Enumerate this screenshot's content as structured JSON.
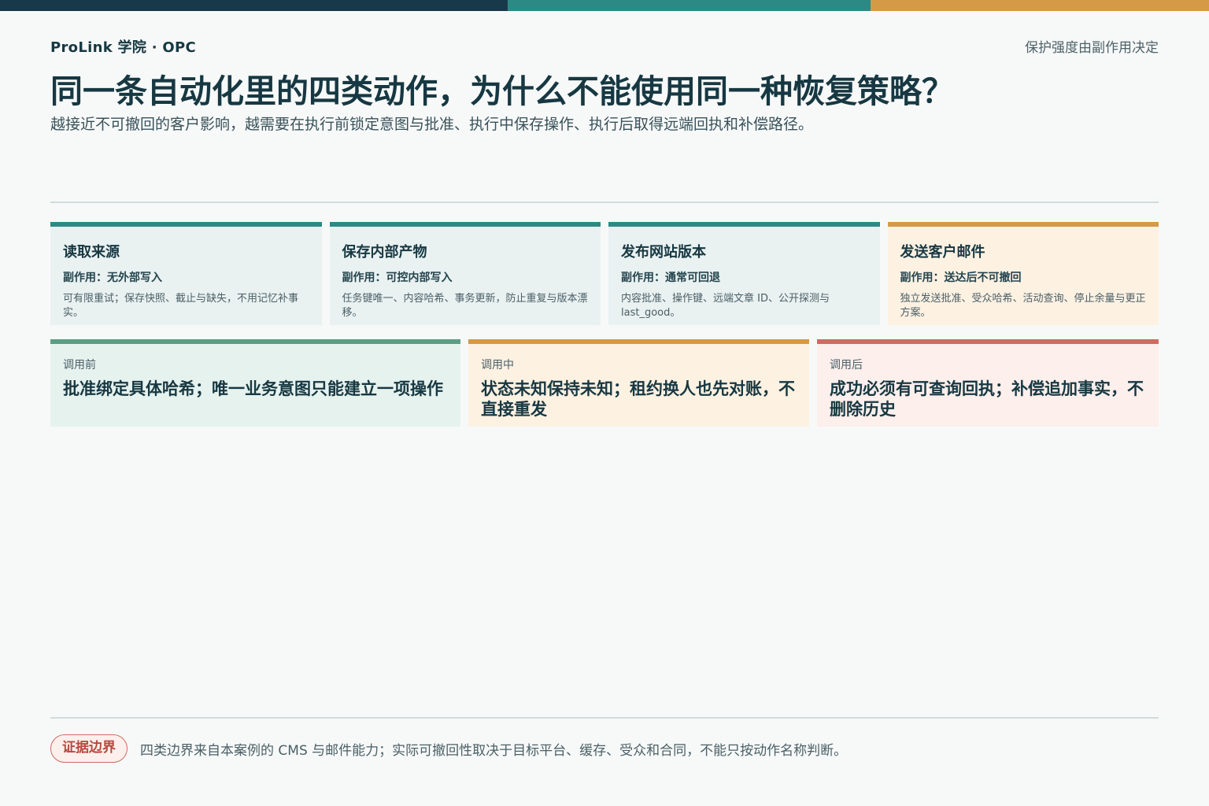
{
  "colors": {
    "navy": "#18394a",
    "teal": "#2b8a84",
    "orange": "#d49a46",
    "green": "#5a9e86",
    "red": "#cf6b60"
  },
  "header": {
    "brand": "ProLink 学院 · OPC",
    "note": "保护强度由副作用决定",
    "title": "同一条自动化里的四类动作，为什么不能使用同一种恢复策略？",
    "subtitle": "越接近不可撤回的客户影响，越需要在执行前锁定意图与批准、执行中保存操作、执行后取得远端回执和补偿路径。"
  },
  "actions": [
    {
      "title": "读取来源",
      "side_effect": "副作用：无外部写入",
      "desc": "可有限重试；保存快照、截止与缺失，不用记忆补事实。"
    },
    {
      "title": "保存内部产物",
      "side_effect": "副作用：可控内部写入",
      "desc": "任务键唯一、内容哈希、事务更新，防止重复与版本漂移。"
    },
    {
      "title": "发布网站版本",
      "side_effect": "副作用：通常可回退",
      "desc": "内容批准、操作键、远端文章 ID、公开探测与 last_good。"
    },
    {
      "title": "发送客户邮件",
      "side_effect": "副作用：送达后不可撤回",
      "desc": "独立发送批准、受众哈希、活动查询、停止余量与更正方案。"
    }
  ],
  "stages": [
    {
      "label": "调用前",
      "text": "批准绑定具体哈希；唯一业务意图只能建立一项操作"
    },
    {
      "label": "调用中",
      "text": "状态未知保持未知；租约换人也先对账，不直接重发"
    },
    {
      "label": "调用后",
      "text": "成功必须有可查询回执；补偿追加事实，不删除历史"
    }
  ],
  "footer": {
    "badge": "证据边界",
    "text": "四类边界来自本案例的 CMS 与邮件能力；实际可撤回性取决于目标平台、缓存、受众和合同，不能只按动作名称判断。"
  }
}
